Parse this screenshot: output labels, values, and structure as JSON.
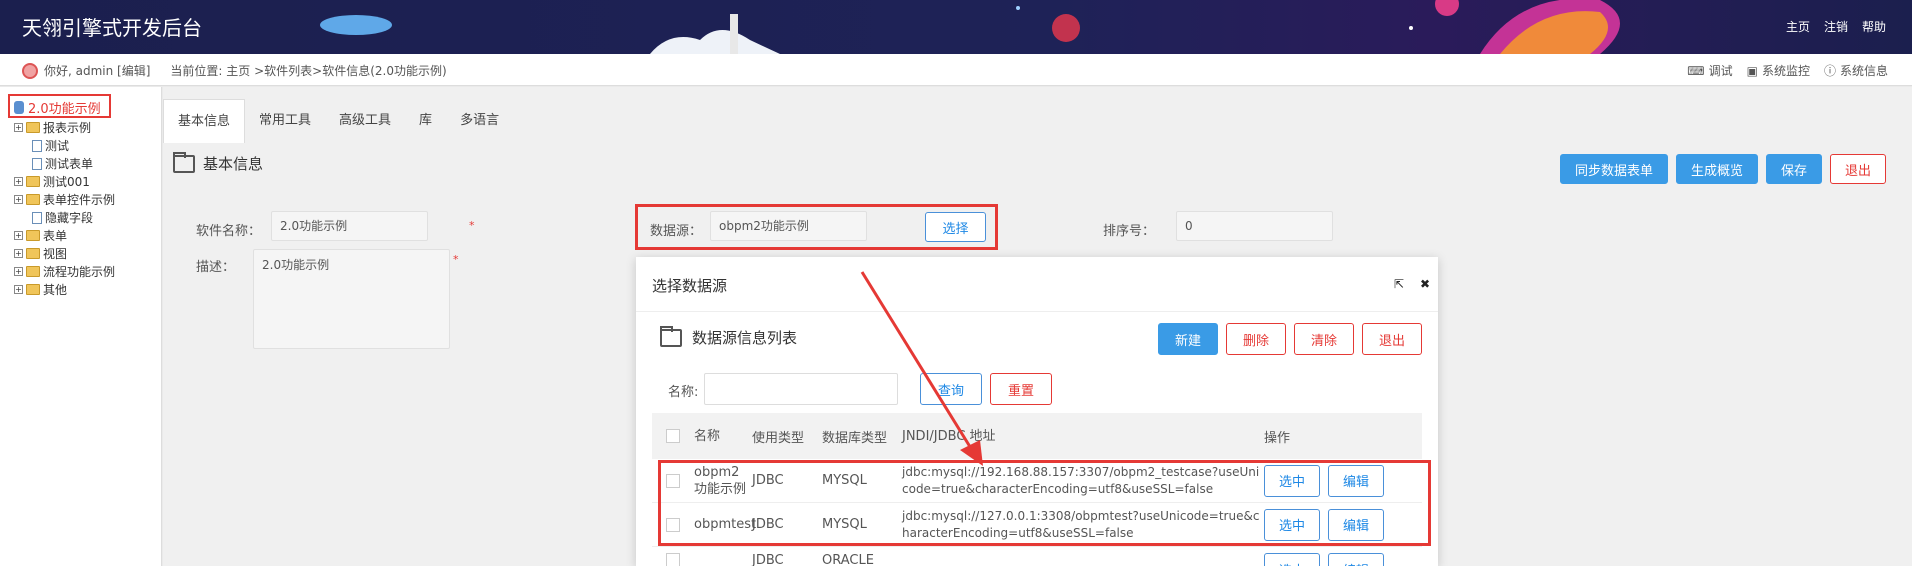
{
  "header": {
    "title": "天翎引擎式开发后台",
    "nav": [
      "主页",
      "注销",
      "帮助"
    ]
  },
  "subbar": {
    "greeting": "你好, admin [编辑]",
    "breadcrumb": "当前位置: 主页 >软件列表>软件信息(2.0功能示例)",
    "tools": [
      "调试",
      "系统监控",
      "系统信息"
    ]
  },
  "tree": {
    "root": "2.0功能示例",
    "nodes": [
      "报表示例",
      "测试",
      "测试表单",
      "测试001",
      "表单控件示例",
      "隐藏字段",
      "表单",
      "视图",
      "流程功能示例",
      "其他"
    ]
  },
  "tabs": [
    "基本信息",
    "常用工具",
    "高级工具",
    "库",
    "多语言"
  ],
  "section": {
    "title": "基本信息"
  },
  "actions": [
    "同步数据表单",
    "生成概览",
    "保存",
    "退出"
  ],
  "form": {
    "name_label": "软件名称：",
    "name_value": "2.0功能示例",
    "datasource_label": "数据源：",
    "datasource_value": "obpm2功能示例",
    "select_label": "选择",
    "order_label": "排序号：",
    "order_value": "0",
    "desc_label": "描述：",
    "desc_value": "2.0功能示例",
    "required_mark": "*"
  },
  "dialog": {
    "title": "选择数据源",
    "list_title": "数据源信息列表",
    "buttons": [
      "新建",
      "删除",
      "清除",
      "退出"
    ],
    "search_label": "名称:",
    "search_value": "",
    "query_label": "查询",
    "reset_label": "重置",
    "columns": [
      "名称",
      "使用类型",
      "数据库类型",
      "JNDI/JDBC 地址",
      "操作"
    ],
    "rows": [
      {
        "name": "obpm2功能示例",
        "type": "JDBC",
        "db": "MYSQL",
        "url": "jdbc:mysql://192.168.88.157:3307/obpm2_testcase?useUnicode=true&characterEncoding=utf8&useSSL=false"
      },
      {
        "name": "obpmtest",
        "type": "JDBC",
        "db": "MYSQL",
        "url": "jdbc:mysql://127.0.0.1:3308/obpmtest?useUnicode=true&characterEncoding=utf8&useSSL=false"
      }
    ],
    "row_actions": [
      "选中",
      "编辑"
    ],
    "partial_row": {
      "type": "JDBC",
      "db": "ORACLE"
    }
  },
  "colors": {
    "primary": "#3a9be6",
    "danger": "#e53935",
    "header_bg": "#1e2257"
  },
  "icons": [
    "avatar-icon",
    "debug-icon",
    "monitor-icon",
    "info-icon",
    "folder-icon",
    "page-icon",
    "popout-icon",
    "close-icon"
  ]
}
